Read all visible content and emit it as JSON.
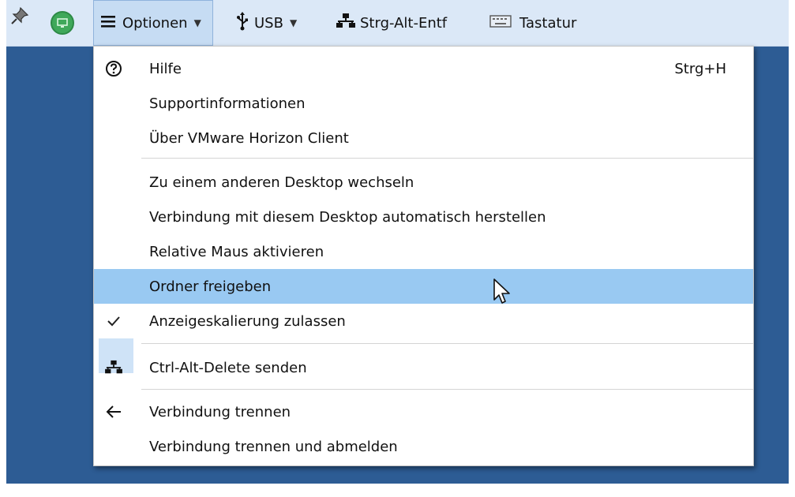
{
  "toolbar": {
    "items": [
      {
        "name": "pin-icon"
      },
      {
        "name": "connection-status-icon"
      },
      {
        "label": "Optionen",
        "icon": "hamburger-menu-icon"
      },
      {
        "label": "USB",
        "icon": "usb-icon"
      },
      {
        "label": "Strg-Alt-Entf",
        "icon": "network-icon"
      },
      {
        "label": "Tastatur",
        "icon": "keyboard-icon"
      }
    ]
  },
  "menu": {
    "items": [
      {
        "label": "Hilfe",
        "shortcut": "Strg+H",
        "icon": "help-circle-icon"
      },
      {
        "label": "Supportinformationen"
      },
      {
        "label": "Über VMware Horizon Client"
      },
      {
        "label": "Zu einem anderen Desktop wechseln"
      },
      {
        "label": "Verbindung mit diesem Desktop automatisch herstellen"
      },
      {
        "label": "Relative Maus aktivieren"
      },
      {
        "label": "Ordner freigeben",
        "highlighted": true
      },
      {
        "label": "Anzeigeskalierung zulassen",
        "checked": true,
        "icon": "checkmark-icon"
      },
      {
        "label": "Ctrl-Alt-Delete senden",
        "icon": "network-icon"
      },
      {
        "label": "Verbindung trennen",
        "icon": "arrow-left-icon"
      },
      {
        "label": "Verbindung trennen und abmelden"
      }
    ]
  },
  "colors": {
    "desktop_bg": "#2d5c94",
    "toolbar_bg": "#dbe8f7",
    "highlight": "#99c9f2",
    "check_band": "#cfe3f7"
  }
}
